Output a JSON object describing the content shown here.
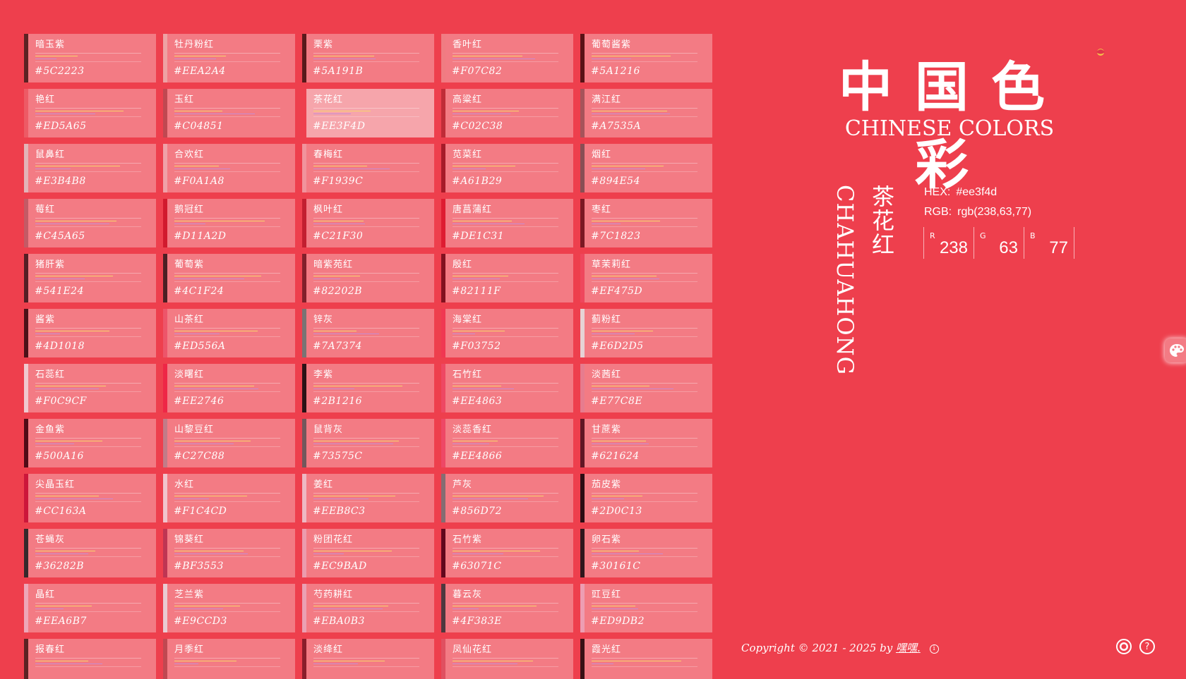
{
  "header": {
    "logo_cn": "中国色彩",
    "logo_en": "CHINESE COLORS"
  },
  "selected": {
    "name": "茶花红",
    "pinyin": "CHAHUAHONG",
    "hex_label": "HEX:",
    "hex": "#ee3f4d",
    "rgb_label": "RGB:",
    "rgb": "rgb(238,63,77)",
    "r_label": "R",
    "r": "238",
    "g_label": "G",
    "g": "63",
    "b_label": "B",
    "b": "77"
  },
  "colors": [
    {
      "name": "暗玉紫",
      "hex": "#5C2223"
    },
    {
      "name": "牡丹粉红",
      "hex": "#EEA2A4"
    },
    {
      "name": "栗紫",
      "hex": "#5A191B"
    },
    {
      "name": "香叶红",
      "hex": "#F07C82"
    },
    {
      "name": "葡萄酱紫",
      "hex": "#5A1216"
    },
    {
      "name": "艳红",
      "hex": "#ED5A65"
    },
    {
      "name": "玉红",
      "hex": "#C04851"
    },
    {
      "name": "茶花红",
      "hex": "#EE3F4D"
    },
    {
      "name": "高粱红",
      "hex": "#C02C38"
    },
    {
      "name": "满江红",
      "hex": "#A7535A"
    },
    {
      "name": "鼠鼻红",
      "hex": "#E3B4B8"
    },
    {
      "name": "合欢红",
      "hex": "#F0A1A8"
    },
    {
      "name": "春梅红",
      "hex": "#F1939C"
    },
    {
      "name": "苋菜红",
      "hex": "#A61B29"
    },
    {
      "name": "烟红",
      "hex": "#894E54"
    },
    {
      "name": "莓红",
      "hex": "#C45A65"
    },
    {
      "name": "鹅冠红",
      "hex": "#D11A2D"
    },
    {
      "name": "枫叶红",
      "hex": "#C21F30"
    },
    {
      "name": "唐菖蒲红",
      "hex": "#DE1C31"
    },
    {
      "name": "枣红",
      "hex": "#7C1823"
    },
    {
      "name": "猪肝紫",
      "hex": "#541E24"
    },
    {
      "name": "葡萄紫",
      "hex": "#4C1F24"
    },
    {
      "name": "暗紫苑红",
      "hex": "#82202B"
    },
    {
      "name": "殷红",
      "hex": "#82111F"
    },
    {
      "name": "草茉莉红",
      "hex": "#EF475D"
    },
    {
      "name": "酱紫",
      "hex": "#4D1018"
    },
    {
      "name": "山茶红",
      "hex": "#ED556A"
    },
    {
      "name": "锌灰",
      "hex": "#7A7374"
    },
    {
      "name": "海棠红",
      "hex": "#F03752"
    },
    {
      "name": "蓟粉红",
      "hex": "#E6D2D5"
    },
    {
      "name": "石蕊红",
      "hex": "#F0C9CF"
    },
    {
      "name": "淡曙红",
      "hex": "#EE2746"
    },
    {
      "name": "李紫",
      "hex": "#2B1216"
    },
    {
      "name": "石竹红",
      "hex": "#EE4863"
    },
    {
      "name": "淡茜红",
      "hex": "#E77C8E"
    },
    {
      "name": "金鱼紫",
      "hex": "#500A16"
    },
    {
      "name": "山黎豆红",
      "hex": "#C27C88"
    },
    {
      "name": "鼠背灰",
      "hex": "#73575C"
    },
    {
      "name": "淡蕊香红",
      "hex": "#EE4866"
    },
    {
      "name": "甘蔗紫",
      "hex": "#621624"
    },
    {
      "name": "尖晶玉红",
      "hex": "#CC163A"
    },
    {
      "name": "水红",
      "hex": "#F1C4CD"
    },
    {
      "name": "姜红",
      "hex": "#EEB8C3"
    },
    {
      "name": "芦灰",
      "hex": "#856D72"
    },
    {
      "name": "茄皮紫",
      "hex": "#2D0C13"
    },
    {
      "name": "苍蝇灰",
      "hex": "#36282B"
    },
    {
      "name": "锦葵红",
      "hex": "#BF3553"
    },
    {
      "name": "粉团花红",
      "hex": "#EC9BAD"
    },
    {
      "name": "石竹紫",
      "hex": "#63071C"
    },
    {
      "name": "卵石紫",
      "hex": "#30161C"
    },
    {
      "name": "晶红",
      "hex": "#EEA6B7"
    },
    {
      "name": "芝兰紫",
      "hex": "#E9CCD3"
    },
    {
      "name": "芍药耕红",
      "hex": "#EBA0B3"
    },
    {
      "name": "暮云灰",
      "hex": "#4F383E"
    },
    {
      "name": "豇豆红",
      "hex": "#ED9DB2"
    },
    {
      "name": "报春红",
      "hex": ""
    },
    {
      "name": "月季红",
      "hex": ""
    },
    {
      "name": "淡绛红",
      "hex": ""
    },
    {
      "name": "凤仙花红",
      "hex": ""
    },
    {
      "name": "霞光红",
      "hex": ""
    }
  ],
  "footer": {
    "copyright": "Copyright © 2021 - 2025 by",
    "author": "嘿嘿.",
    "info": "i",
    "help": "?"
  },
  "icons": {
    "github": "github-icon",
    "help": "help-icon",
    "palette": "palette-icon",
    "lotus": "lotus-icon"
  }
}
